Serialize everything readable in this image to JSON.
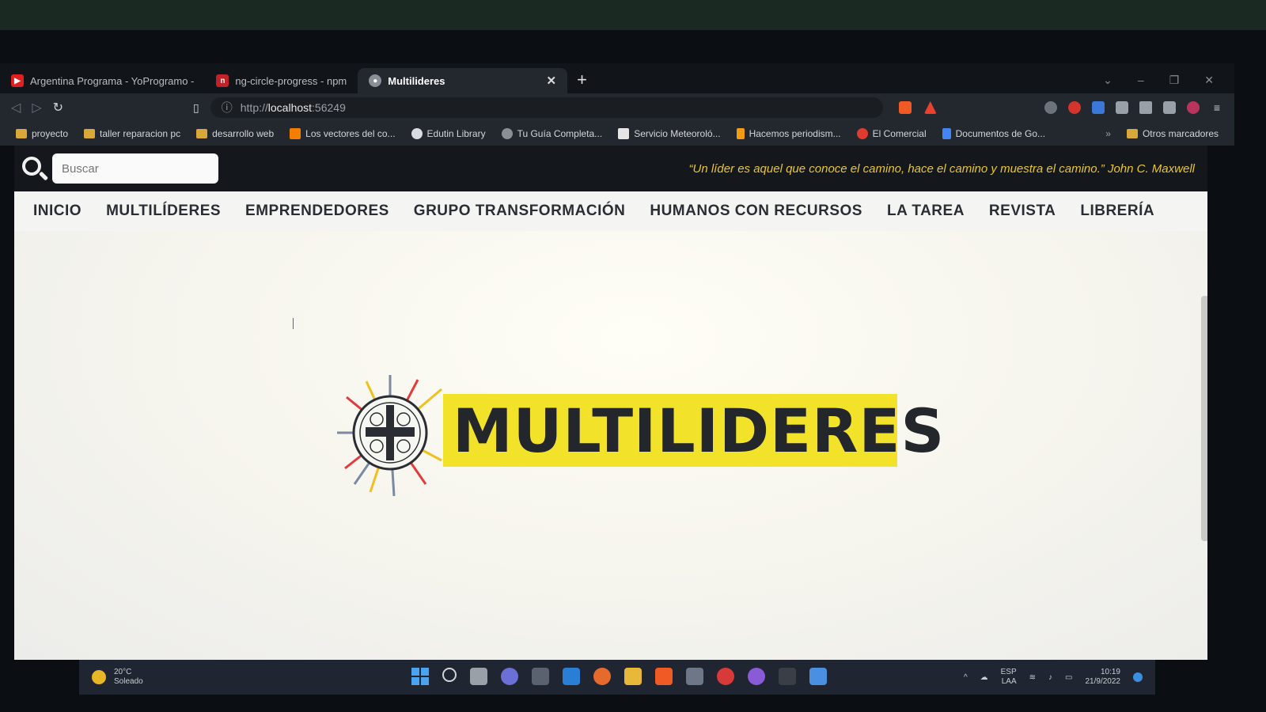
{
  "browser": {
    "tabs": [
      {
        "label": "Argentina Programa - YoProgramo -",
        "icon": "youtube-icon",
        "color": "#e02020"
      },
      {
        "label": "ng-circle-progress - npm",
        "icon": "npm-icon",
        "color": "#c12127"
      },
      {
        "label": "Multilideres",
        "icon": "globe-icon",
        "color": "#8a8f96",
        "active": true
      }
    ],
    "new_tab": "+",
    "url_scheme": "http://",
    "url_host": "localhost",
    "url_port": ":56249",
    "bookmarks": [
      {
        "label": "proyecto",
        "icon": "folder-icon"
      },
      {
        "label": "taller reparacion pc",
        "icon": "folder-icon"
      },
      {
        "label": "desarrollo web",
        "icon": "folder-icon"
      },
      {
        "label": "Los vectores del co...",
        "icon": "blogger-icon"
      },
      {
        "label": "Edutin Library",
        "icon": "edutin-icon"
      },
      {
        "label": "Tu Guía Completa...",
        "icon": "globe-icon"
      },
      {
        "label": "Servicio Meteoroló...",
        "icon": "weather-site-icon"
      },
      {
        "label": "Hacemos periodism...",
        "icon": "info-icon"
      },
      {
        "label": "El Comercial",
        "icon": "elcomercial-icon"
      },
      {
        "label": "Documentos de Go...",
        "icon": "docs-icon"
      }
    ],
    "bookmarks_more": "»",
    "other_bookmarks": "Otros marcadores"
  },
  "site": {
    "search_placeholder": "Buscar",
    "quote": "“Un líder es aquel que conoce el camino, hace el camino y muestra el camino.” John C. Maxwell",
    "nav": [
      "INICIO",
      "MULTILÍDERES",
      "EMPRENDEDORES",
      "GRUPO TRANSFORMACIÓN",
      "HUMANOS CON RECURSOS",
      "LA TAREA",
      "REVISTA",
      "LIBRERÍA"
    ],
    "logo_text": "MULTILIDERES",
    "colors": {
      "accent_yellow": "#f2e32a",
      "quote_yellow": "#e8c531",
      "topbar": "#14181c"
    }
  },
  "taskbar": {
    "temperature": "20°C",
    "weather": "Soleado",
    "lang_1": "ESP",
    "lang_2": "LAA",
    "time": "10:19",
    "date": "21/9/2022"
  }
}
